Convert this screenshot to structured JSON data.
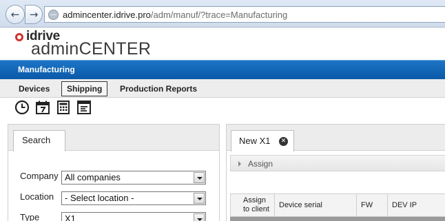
{
  "browser": {
    "url_host": "admincenter.idrive.pro",
    "url_path": "/adm/manuf/?trace=Manufacturing",
    "back_icon": "←",
    "forward_icon": "→"
  },
  "logo": {
    "brand": "idrive",
    "product": "adminCENTER"
  },
  "app": {
    "title": "Manufacturing"
  },
  "menu": {
    "items": [
      {
        "label": "Devices"
      },
      {
        "label": "Shipping"
      },
      {
        "label": "Production Reports"
      }
    ],
    "active": "Shipping"
  },
  "toolbar": {
    "icons": [
      "clock-icon",
      "calendar-icon",
      "calculator-icon",
      "report-icon"
    ]
  },
  "search_panel": {
    "tab_label": "Search",
    "fields": [
      {
        "label": "Company",
        "value": "All companies"
      },
      {
        "label": "Location",
        "value": "- Select location -"
      },
      {
        "label": "Type",
        "value": "X1"
      }
    ]
  },
  "detail_panel": {
    "tab_label": "New X1",
    "close_icon": "✕",
    "assign_label": "Assign",
    "columns": [
      "Assign to client",
      "Device serial",
      "FW",
      "DEV IP"
    ]
  },
  "colors": {
    "brand_blue": "#0a5aa8",
    "logo_red": "#d0342c"
  }
}
